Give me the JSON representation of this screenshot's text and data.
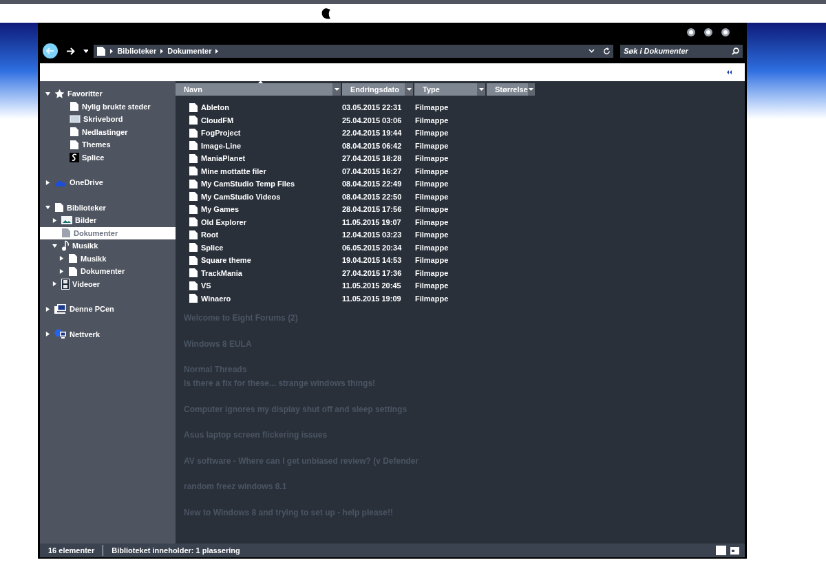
{
  "window_controls": [
    {
      "kind": "dot"
    },
    {
      "kind": "dot"
    },
    {
      "kind": "dot"
    }
  ],
  "navigation": {
    "breadcrumb": [
      "Biblioteker",
      "Dokumenter"
    ],
    "search": {
      "placeholder": "Søk i Dokumenter"
    }
  },
  "sidebar": {
    "items": [
      {
        "label": "Favoritter",
        "kind": "star",
        "expanded": true,
        "selected": false,
        "children": [
          {
            "label": "Nylig brukte steder",
            "kind": "folder",
            "selected": false
          },
          {
            "label": "Skrivebord",
            "kind": "desktop",
            "selected": false
          },
          {
            "label": "Nedlastinger",
            "kind": "folder",
            "selected": false
          },
          {
            "label": "Themes",
            "kind": "folder",
            "selected": false
          },
          {
            "label": "Splice",
            "kind": "splice",
            "selected": false
          }
        ]
      },
      {
        "label": "OneDrive",
        "kind": "cloud",
        "expanded": false,
        "selected": false
      },
      {
        "label": "Biblioteker",
        "kind": "folder",
        "expanded": true,
        "selected": false,
        "children": [
          {
            "label": "Bilder",
            "kind": "pictures",
            "expanded": false,
            "selected": false
          },
          {
            "label": "Dokumenter",
            "kind": "folder",
            "selected": true
          },
          {
            "label": "Musikk",
            "kind": "music",
            "expanded": true,
            "selected": false,
            "children": [
              {
                "label": "Musikk",
                "kind": "folder",
                "expanded": false,
                "selected": false
              },
              {
                "label": "Dokumenter",
                "kind": "folder",
                "expanded": false,
                "selected": false
              }
            ]
          },
          {
            "label": "Videoer",
            "kind": "video",
            "expanded": false,
            "selected": false
          }
        ]
      },
      {
        "label": "Denne PCen",
        "kind": "pc",
        "expanded": false,
        "selected": false
      },
      {
        "label": "Nettverk",
        "kind": "network",
        "expanded": false,
        "selected": false
      }
    ]
  },
  "table": {
    "columns": [
      {
        "label": "Navn",
        "sorted": true
      },
      {
        "label": "Endringsdato",
        "sorted": false
      },
      {
        "label": "Type",
        "sorted": false
      },
      {
        "label": "Størrelse",
        "sorted": false
      }
    ],
    "rows": [
      {
        "name": "Ableton",
        "date": "03.05.2015 22:31",
        "type": "Filmappe"
      },
      {
        "name": "CloudFM",
        "date": "25.04.2015 03:06",
        "type": "Filmappe"
      },
      {
        "name": "FogProject",
        "date": "22.04.2015 19:44",
        "type": "Filmappe"
      },
      {
        "name": "Image-Line",
        "date": "08.04.2015 06:42",
        "type": "Filmappe"
      },
      {
        "name": "ManiaPlanet",
        "date": "27.04.2015 18:28",
        "type": "Filmappe"
      },
      {
        "name": "Mine mottatte filer",
        "date": "07.04.2015 16:27",
        "type": "Filmappe"
      },
      {
        "name": "My CamStudio Temp Files",
        "date": "08.04.2015 22:49",
        "type": "Filmappe"
      },
      {
        "name": "My CamStudio Videos",
        "date": "08.04.2015 22:50",
        "type": "Filmappe"
      },
      {
        "name": "My Games",
        "date": "28.04.2015 17:56",
        "type": "Filmappe"
      },
      {
        "name": "Old Explorer",
        "date": "11.05.2015 19:07",
        "type": "Filmappe"
      },
      {
        "name": "Root",
        "date": "12.04.2015 03:23",
        "type": "Filmappe"
      },
      {
        "name": "Splice",
        "date": "06.05.2015 20:34",
        "type": "Filmappe"
      },
      {
        "name": "Square theme",
        "date": "19.04.2015 14:53",
        "type": "Filmappe"
      },
      {
        "name": "TrackMania",
        "date": "27.04.2015 17:36",
        "type": "Filmappe"
      },
      {
        "name": "VS",
        "date": "11.05.2015 20:45",
        "type": "Filmappe"
      },
      {
        "name": "Winaero",
        "date": "11.05.2015 19:09",
        "type": "Filmappe"
      }
    ]
  },
  "background_forum": {
    "items": [
      {
        "kind": "thread",
        "title": "Welcome to Eight Forums (2)"
      },
      {
        "kind": "thread",
        "title": "Windows 8 EULA"
      },
      {
        "kind": "heading",
        "title": "Normal Threads"
      },
      {
        "kind": "thread",
        "title": "Is there a fix for these... strange windows things!"
      },
      {
        "kind": "thread",
        "title": "Computer ignores my display shut off and sleep settings"
      },
      {
        "kind": "thread",
        "title": "Asus laptop screen flickering issues"
      },
      {
        "kind": "thread",
        "title": "AV software - Where can I get unbiased review? (v Defender"
      },
      {
        "kind": "thread",
        "title": "random freez windows 8.1"
      },
      {
        "kind": "thread",
        "title": "New to Windows 8 and trying to set up - help please!!"
      }
    ]
  },
  "status_bar": [
    "16 elementer",
    "Biblioteket inneholder: 1 plassering"
  ]
}
